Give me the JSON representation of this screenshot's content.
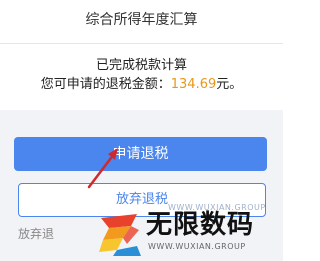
{
  "header": {
    "title": "综合所得年度汇算"
  },
  "result": {
    "status_text": "已完成税款计算",
    "refund_prefix": "您可申请的退税金额：",
    "refund_amount": "134.69",
    "refund_suffix": "元。"
  },
  "actions": {
    "apply_label": "申请退税",
    "giveup_label": "放弃退税",
    "bottom_link_label": "放弃退"
  },
  "watermark": {
    "brand_text": "无限数码",
    "url_text": "WWW.WUXIAN.GROUP",
    "url_text_top": "WWW.WUXIAN.GROUP"
  },
  "colors": {
    "accent": "#4b85ee",
    "amount": "#e8971a",
    "annotation_arrow": "#d0282f"
  }
}
